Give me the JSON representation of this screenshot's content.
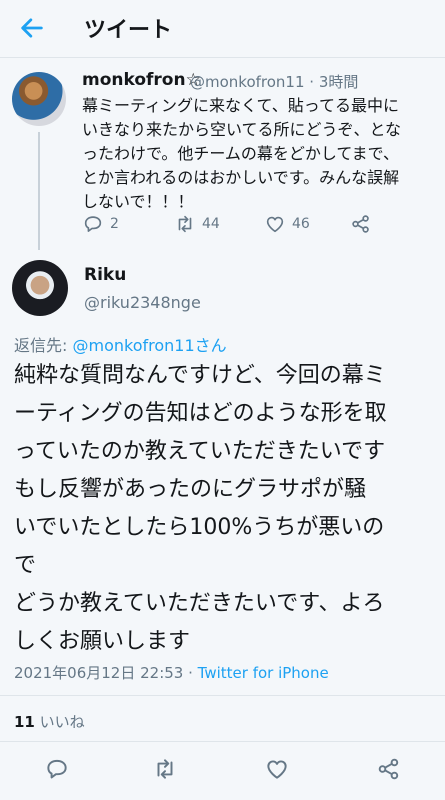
{
  "header": {
    "title": "ツイート"
  },
  "parent": {
    "name": "monkofron☆",
    "handle": "@monkofron11 · 3時間",
    "text": "幕ミーティングに来なくて、貼ってる最中に\nいきなり来たから空いてる所にどうぞ、とな\nったわけで。他チームの幕をどかしてまで、\nとか言われるのはおかしいです。みんな誤解\nしないで！！！",
    "reply_count": "2",
    "retweet_count": "44",
    "like_count": "46"
  },
  "reply": {
    "name": "Riku",
    "handle": "@riku2348nge",
    "reply_to_label": "返信先: ",
    "reply_to_link": "@monkofron11さん",
    "text": "純粋な質問なんですけど、今回の幕ミ\nーティングの告知はどのような形を取\nっていたのか教えていただきたいです\nもし反響があったのにグラサポが騒\nいでいたとしたら100%うちが悪いの\nで\nどうか教えていただきたいです、よろ\nしくお願いします",
    "timestamp": "2021年06月12日 22:53 · ",
    "source": "Twitter for iPhone",
    "likes_count": "11",
    "likes_label": " いいね"
  },
  "colors": {
    "accent": "#1da1f2",
    "muted": "#657786",
    "text": "#14171a",
    "background": "#f4f7fa"
  }
}
